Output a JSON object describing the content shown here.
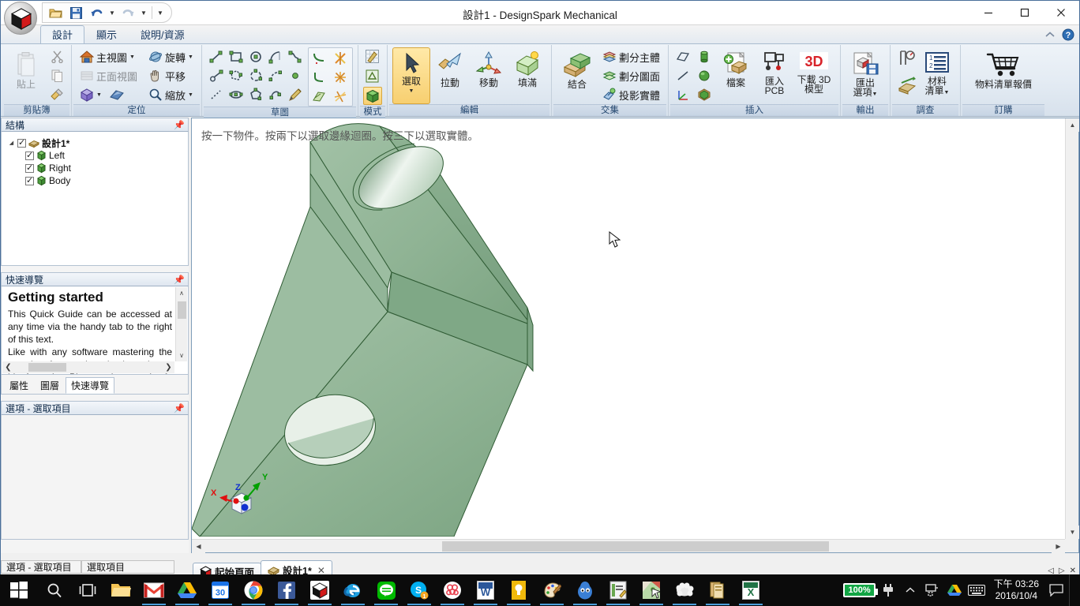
{
  "window": {
    "title": "設計1 - DesignSpark Mechanical",
    "minimize": "—",
    "maximize": "□",
    "close": "✕"
  },
  "quick_access": {
    "open": "open-icon",
    "save": "save-icon",
    "undo": "undo-icon",
    "redo": "redo-icon",
    "customize": "customize-icon"
  },
  "ribbon": {
    "tabs": [
      {
        "label": "設計",
        "active": true
      },
      {
        "label": "顯示",
        "active": false
      },
      {
        "label": "說明/資源",
        "active": false
      }
    ],
    "collapse_icon": "chevron-up-icon",
    "help_icon": "help-icon",
    "groups": [
      {
        "title": "剪貼簿",
        "paste_label": "貼上",
        "items": [
          {
            "label": "剪下",
            "icon": "scissors-icon"
          },
          {
            "label": "複製",
            "icon": "copy-icon"
          },
          {
            "label": "複製格式",
            "icon": "format-painter-icon"
          }
        ]
      },
      {
        "title": "定位",
        "items": [
          {
            "label": "主視圖",
            "icon": "home-view-icon",
            "has_caret": true,
            "disabled": false
          },
          {
            "label": "旋轉",
            "icon": "rotate-icon",
            "has_caret": true,
            "disabled": false
          },
          {
            "label": "正面視圖",
            "icon": "front-view-icon",
            "has_caret": false,
            "disabled": true
          },
          {
            "label": "平移",
            "icon": "pan-hand-icon",
            "has_caret": false,
            "disabled": false
          },
          {
            "label": "",
            "icon": "iso-cube-icon",
            "has_caret": true,
            "disabled": false
          },
          {
            "label": "",
            "icon": "plane-view-icon",
            "has_caret": false,
            "disabled": false
          },
          {
            "label": "縮放",
            "icon": "zoom-icon",
            "has_caret": true,
            "disabled": false
          }
        ]
      },
      {
        "title": "草圖",
        "tools": [
          "line-icon",
          "rectangle-icon",
          "circle-icon",
          "arc-icon",
          "spline-icon",
          "tangent-line-icon",
          "polygon-icon",
          "three-point-arc-icon",
          "tangent-arc-icon",
          "point-icon",
          "construction-line-icon",
          "ellipse-icon",
          "polygon-n-icon",
          "sketch-arc-icon",
          "pencil-edit-icon"
        ],
        "modifiers": [
          "trim-icon",
          "split-icon",
          "fillet-icon",
          "explode-icon",
          "project-icon",
          "break-icon"
        ]
      },
      {
        "title": "模式",
        "items": [
          {
            "icon": "sketch-mode-icon",
            "active": false
          },
          {
            "icon": "section-mode-icon",
            "active": false
          },
          {
            "icon": "solid-mode-icon",
            "active": true
          }
        ]
      },
      {
        "title": "編輯",
        "items": [
          {
            "label": "選取",
            "icon": "select-arrow-icon",
            "active": true,
            "has_caret": true
          },
          {
            "label": "拉動",
            "icon": "pull-icon",
            "active": false
          },
          {
            "label": "移動",
            "icon": "move-icon",
            "active": false
          },
          {
            "label": "填滿",
            "icon": "fill-icon",
            "active": false
          }
        ]
      },
      {
        "title": "交集",
        "combine_label": "結合",
        "items": [
          {
            "label": "劃分主體",
            "icon": "split-body-icon"
          },
          {
            "label": "劃分圖面",
            "icon": "split-face-icon"
          },
          {
            "label": "投影實體",
            "icon": "project-solid-icon"
          }
        ]
      },
      {
        "title": "插入",
        "small_tools": [
          "plane-icon",
          "cylinder-icon",
          "axis-line-icon",
          "sphere-icon",
          "origin-icon",
          "shell-icon"
        ],
        "items": [
          {
            "label": "檔案",
            "icon": "insert-file-icon"
          },
          {
            "label": "匯入 PCB",
            "icon": "import-pcb-icon"
          },
          {
            "label": "下載 3D 模型",
            "icon": "download-3d-icon"
          }
        ]
      },
      {
        "title": "輸出",
        "items": [
          {
            "label": "匯出 選項",
            "icon": "export-options-icon",
            "has_caret": true
          }
        ]
      },
      {
        "title": "調查",
        "small_tools": [
          "measure-icon",
          "mass-properties-icon"
        ],
        "items": [
          {
            "label": "材料 清單",
            "icon": "bom-list-icon",
            "has_caret": true
          }
        ]
      },
      {
        "title": "訂購",
        "items": [
          {
            "label": "物料清單報價",
            "icon": "cart-icon"
          }
        ]
      }
    ]
  },
  "structure_panel": {
    "title": "結構",
    "pin_icon": "pin-icon",
    "tree": [
      {
        "label": "設計1*",
        "level": 0,
        "checked": true,
        "bold": true,
        "icon": "design-icon",
        "expander": "▲"
      },
      {
        "label": "Left",
        "level": 1,
        "checked": true,
        "bold": false,
        "icon": "body-icon"
      },
      {
        "label": "Right",
        "level": 1,
        "checked": true,
        "bold": false,
        "icon": "body-icon"
      },
      {
        "label": "Body",
        "level": 1,
        "checked": true,
        "bold": false,
        "icon": "body-icon"
      }
    ]
  },
  "quick_guide": {
    "title": "快速導覽",
    "pin_icon": "pin-icon",
    "heading": "Getting started",
    "paragraph1": "This Quick Guide can be accessed at any time via the handy tab to the right of this text.",
    "paragraph2": "Like with any software mastering the user interface and navigation takes a bit of practice. Please select a topic of",
    "prev_icon": "prev-arrow-icon",
    "next_icon": "next-arrow-icon",
    "tabs": [
      {
        "label": "屬性",
        "active": false
      },
      {
        "label": "圖層",
        "active": false
      },
      {
        "label": "快速導覽",
        "active": true
      }
    ]
  },
  "options_panel": {
    "title": "選項 - 選取項目",
    "pin_icon": "pin-icon"
  },
  "viewport": {
    "hint": "按一下物件。按兩下以選取邊緣迴圈。按三下以選取實體。",
    "model_color": "#8fb394",
    "model_color_light": "#a7c5ab",
    "model_color_dark": "#7ea585",
    "edge_color": "#2f5b34",
    "axes": [
      {
        "label": "X",
        "color": "#e01010"
      },
      {
        "label": "Y",
        "color": "#00a000"
      },
      {
        "label": "Z",
        "color": "#1030d0"
      }
    ]
  },
  "statusbar": {
    "cells": [
      "選項 - 選取項目",
      "選取項目"
    ],
    "nav_prev": "◁",
    "nav_next": "▷",
    "nav_close": "✕"
  },
  "document_tabs": [
    {
      "label": "起始頁面",
      "icon": "start-page-icon",
      "active": false,
      "closable": false
    },
    {
      "label": "設計1*",
      "icon": "design-doc-icon",
      "active": true,
      "closable": true
    }
  ],
  "taskbar": {
    "start_icon": "windows-start-icon",
    "search_icon": "search-icon",
    "taskview_icon": "task-view-icon",
    "apps": [
      {
        "name": "file-explorer-icon",
        "open": false
      },
      {
        "name": "gmail-icon",
        "open": true
      },
      {
        "name": "google-drive-icon",
        "open": true
      },
      {
        "name": "calendar-icon",
        "open": true
      },
      {
        "name": "chrome-icon",
        "open": true
      },
      {
        "name": "facebook-icon",
        "open": true
      },
      {
        "name": "designspark-icon",
        "open": true
      },
      {
        "name": "internet-explorer-icon",
        "open": true
      },
      {
        "name": "line-icon",
        "open": true
      },
      {
        "name": "skype-icon",
        "open": true
      },
      {
        "name": "dropbox-icon",
        "open": true
      },
      {
        "name": "word-icon",
        "open": true
      },
      {
        "name": "notes-icon",
        "open": true
      },
      {
        "name": "paint-icon",
        "open": true
      },
      {
        "name": "gimp-icon",
        "open": true
      },
      {
        "name": "editor-icon",
        "open": true
      },
      {
        "name": "photos-icon",
        "open": true
      },
      {
        "name": "sheep-icon",
        "open": true
      },
      {
        "name": "documents-icon",
        "open": true
      },
      {
        "name": "excel-icon",
        "open": true
      }
    ],
    "tray": {
      "battery": "100%",
      "power_icon": "power-plug-icon",
      "chevron_icon": "show-hidden-icon",
      "network_icon": "network-icon",
      "drive_icon": "google-drive-tray-icon",
      "keyboard_icon": "keyboard-icon",
      "time": "下午 03:26",
      "date": "2016/10/4",
      "action_center_icon": "action-center-icon"
    }
  }
}
